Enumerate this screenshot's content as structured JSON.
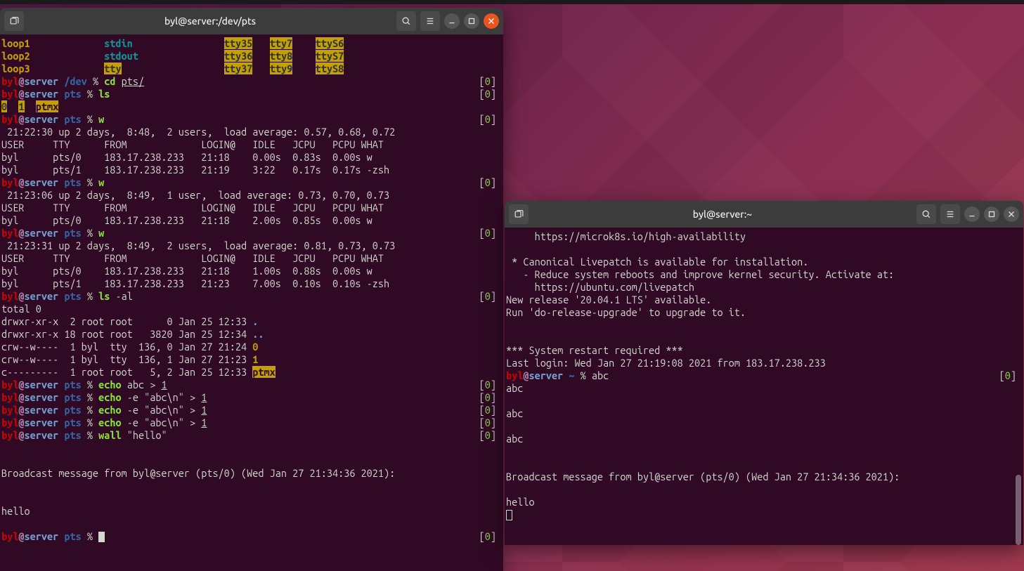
{
  "win1": {
    "title": "byl@server:/dev/pts",
    "toplist": {
      "loop": [
        "loop1",
        "loop2",
        "loop3"
      ],
      "std": [
        "stdin",
        "stdout",
        "tty"
      ],
      "ttya": [
        "tty35",
        "tty36",
        "tty37"
      ],
      "ttyb": [
        "tty7",
        "tty8",
        "tty9"
      ],
      "ttys": [
        "ttyS6",
        "ttyS7",
        "ttyS8"
      ]
    },
    "lines": [
      {
        "prompt": {
          "user": "byl",
          "host": "server",
          "path": "/dev",
          "cmd": "cd ",
          "target": "pts/"
        },
        "ret": "0"
      },
      {
        "prompt": {
          "user": "byl",
          "host": "server",
          "path": "pts",
          "cmd": "ls"
        },
        "ret": "0"
      },
      {
        "lscontent": [
          "0",
          "1",
          "ptmx"
        ]
      },
      {
        "prompt": {
          "user": "byl",
          "host": "server",
          "path": "pts",
          "cmd": "w"
        },
        "ret": "0"
      },
      {
        "out": " 21:22:30 up 2 days,  8:48,  2 users,  load average: 0.57, 0.68, 0.72"
      },
      {
        "out": "USER     TTY      FROM             LOGIN@   IDLE   JCPU   PCPU WHAT"
      },
      {
        "out": "byl      pts/0    183.17.238.233   21:18    0.00s  0.83s  0.00s w"
      },
      {
        "out": "byl      pts/1    183.17.238.233   21:19    3:22   0.17s  0.17s -zsh"
      },
      {
        "prompt": {
          "user": "byl",
          "host": "server",
          "path": "pts",
          "cmd": "w"
        },
        "ret": "0"
      },
      {
        "out": " 21:23:06 up 2 days,  8:49,  1 user,  load average: 0.73, 0.70, 0.73"
      },
      {
        "out": "USER     TTY      FROM             LOGIN@   IDLE   JCPU   PCPU WHAT"
      },
      {
        "out": "byl      pts/0    183.17.238.233   21:18    2.00s  0.85s  0.00s w"
      },
      {
        "prompt": {
          "user": "byl",
          "host": "server",
          "path": "pts",
          "cmd": "w"
        },
        "ret": "0"
      },
      {
        "out": " 21:23:31 up 2 days,  8:49,  2 users,  load average: 0.81, 0.73, 0.73"
      },
      {
        "out": "USER     TTY      FROM             LOGIN@   IDLE   JCPU   PCPU WHAT"
      },
      {
        "out": "byl      pts/0    183.17.238.233   21:18    1.00s  0.88s  0.00s w"
      },
      {
        "out": "byl      pts/1    183.17.238.233   21:23    7.00s  0.10s  0.10s -zsh"
      },
      {
        "prompt": {
          "user": "byl",
          "host": "server",
          "path": "pts",
          "cmd": "ls ",
          "args": "-al"
        },
        "ret": "0"
      },
      {
        "out": "total 0"
      },
      {
        "lsl": "drwxr-xr-x  2 root root      0 Jan 25 12:33 ",
        "tail": ".",
        "tailcls": "dot"
      },
      {
        "lsl": "drwxr-xr-x 18 root root   3820 Jan 25 12:34 ",
        "tail": "..",
        "tailcls": "dot"
      },
      {
        "lsl": "crw--w----  1 byl  tty  136, 0 Jan 27 21:24 ",
        "tail": "0",
        "tailcls": "num-pt"
      },
      {
        "lsl": "crw--w----  1 byl  tty  136, 1 Jan 27 21:23 ",
        "tail": "1",
        "tailcls": "num-pt"
      },
      {
        "lsl": "c---------  1 root root   5, 2 Jan 25 12:33 ",
        "tail": "ptmx",
        "tailcls": "hl-ptmx"
      },
      {
        "prompt": {
          "user": "byl",
          "host": "server",
          "path": "pts",
          "cmd": "echo ",
          "args": "abc > ",
          "ul": "1"
        },
        "ret": "0"
      },
      {
        "prompt": {
          "user": "byl",
          "host": "server",
          "path": "pts",
          "cmd": "echo ",
          "args": "-e \"abc\\n\" > ",
          "ul": "1"
        },
        "ret": "0"
      },
      {
        "prompt": {
          "user": "byl",
          "host": "server",
          "path": "pts",
          "cmd": "echo ",
          "args": "-e \"abc\\n\" > ",
          "ul": "1"
        },
        "ret": "0"
      },
      {
        "prompt": {
          "user": "byl",
          "host": "server",
          "path": "pts",
          "cmd": "echo ",
          "args": "-e \"abc\\n\" > ",
          "ul": "1"
        },
        "ret": "0"
      },
      {
        "prompt": {
          "user": "byl",
          "host": "server",
          "path": "pts",
          "cmd": "wall ",
          "args": "\"hello\""
        },
        "ret": "0"
      },
      {
        "out": ""
      },
      {
        "out": ""
      },
      {
        "out": "Broadcast message from byl@server (pts/0) (Wed Jan 27 21:34:36 2021):"
      },
      {
        "out": ""
      },
      {
        "out": ""
      },
      {
        "out": "hello"
      },
      {
        "out": ""
      },
      {
        "prompt": {
          "user": "byl",
          "host": "server",
          "path": "pts",
          "cmd": "",
          "cursor": true
        },
        "ret": "0"
      }
    ]
  },
  "win2": {
    "title": "byl@server:~",
    "lines": [
      {
        "out": "     https://microk8s.io/high-availability"
      },
      {
        "out": ""
      },
      {
        "out": " * Canonical Livepatch is available for installation."
      },
      {
        "out": "   - Reduce system reboots and improve kernel security. Activate at:"
      },
      {
        "out": "     https://ubuntu.com/livepatch"
      },
      {
        "out": "New release '20.04.1 LTS' available."
      },
      {
        "out": "Run 'do-release-upgrade' to upgrade to it."
      },
      {
        "out": ""
      },
      {
        "out": ""
      },
      {
        "out": "*** System restart required ***"
      },
      {
        "out": "Last login: Wed Jan 27 21:19:08 2021 from 183.17.238.233"
      },
      {
        "prompt": {
          "user": "byl",
          "host": "server",
          "path": "~",
          "args": "abc"
        },
        "ret": "0"
      },
      {
        "out": "abc"
      },
      {
        "out": ""
      },
      {
        "out": "abc"
      },
      {
        "out": ""
      },
      {
        "out": "abc"
      },
      {
        "out": ""
      },
      {
        "out": ""
      },
      {
        "out": "Broadcast message from byl@server (pts/0) (Wed Jan 27 21:34:36 2021):"
      },
      {
        "out": ""
      },
      {
        "out": "hello"
      },
      {
        "cursor_outline": true
      }
    ]
  }
}
